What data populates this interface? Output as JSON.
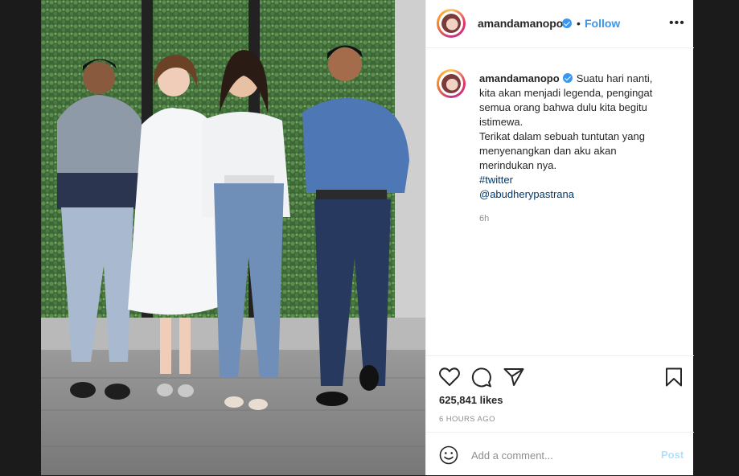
{
  "post": {
    "username": "amandamanopo",
    "separator": "•",
    "follow_label": "Follow",
    "more_label": "•••",
    "caption": {
      "username": "amandamanopo",
      "line1": "Suatu hari nanti, kita akan menjadi legenda, pengingat semua orang bahwa dulu kita begitu istimewa.",
      "line2": "Terikat dalam sebuah tuntutan yang menyenangkan dan aku akan merindukan nya.",
      "hashtag": "#twitter",
      "mention": "@abudherypastrana",
      "time": "6h"
    },
    "icons": {
      "like": "heart-icon",
      "comment": "comment-icon",
      "share": "share-icon",
      "save": "bookmark-icon"
    },
    "likes": "625,841 likes",
    "posted_ago": "6 HOURS AGO",
    "comment": {
      "placeholder": "Add a comment...",
      "value": "",
      "post_label": "Post"
    }
  },
  "photo": {
    "alt_description": "",
    "colors": {
      "hedge": "#3f6b3a",
      "floor": "#8f8f8f",
      "wall": "#cfcfcf"
    }
  },
  "colors": {
    "accent": "#3897f0",
    "link": "#00376b",
    "muted": "#8e8e8e",
    "post_disabled": "#b2dffc"
  }
}
